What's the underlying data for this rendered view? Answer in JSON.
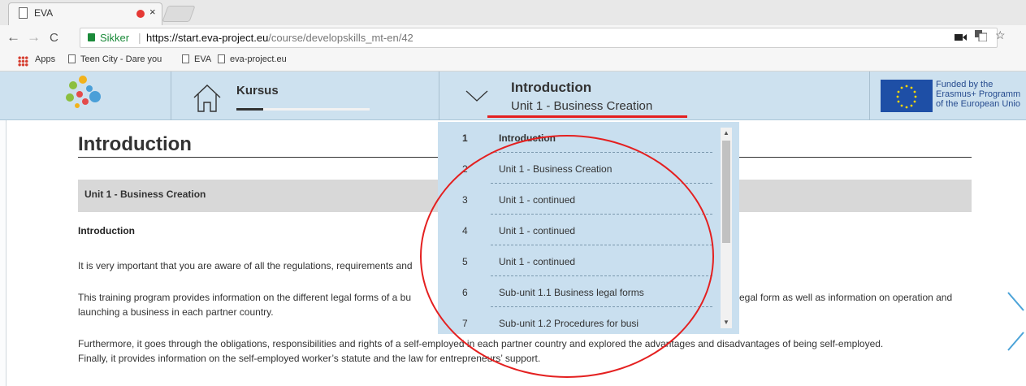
{
  "browser": {
    "tab": {
      "title": "EVA",
      "close": "×"
    },
    "address": {
      "secure_label": "Sikker",
      "url_host": "https://start.eva-project.eu",
      "url_path": "/course/developskills_mt-en/42"
    },
    "nav": {
      "back": "←",
      "forward": "→",
      "reload": "C"
    },
    "bookmarks": [
      {
        "label": "Apps"
      },
      {
        "label": "Teen City - Dare you"
      },
      {
        "label": "EVA"
      },
      {
        "label": "eva-project.eu"
      }
    ],
    "toolbar_icons": [
      "camera-icon",
      "translate-icon",
      "star-icon"
    ]
  },
  "header": {
    "course_label": "Kursus",
    "progress": 0.2,
    "section_title": "Introduction",
    "section_subtitle": "Unit 1 - Business Creation",
    "funding_lines": [
      "Funded by the",
      "Erasmus+ Programm",
      "of the European Unio"
    ]
  },
  "page": {
    "title": "Introduction",
    "unit_title": "Unit 1 - Business Creation",
    "sub_heading": "Introduction",
    "paragraphs": [
      [
        "It is very important that you are aware of all the regulations, requirements and"
      ],
      [
        "This training program provides information on the different legal forms of a bu",
        "egal form as well as information on operation and",
        "launching a business in each partner country."
      ],
      [
        "Furthermore, it goes through the obligations, responsibilities and rights of a self-employed in each partner country and explored the advantages and disadvantages of being self-employed.",
        "Finally, it provides information on the self-employed worker’s statute and the law for entrepreneurs’ support."
      ]
    ]
  },
  "dropdown": {
    "items": [
      {
        "num": "1",
        "label": "Introduction",
        "active": true
      },
      {
        "num": "2",
        "label": "Unit 1 - Business Creation"
      },
      {
        "num": "3",
        "label": "Unit 1 - continued"
      },
      {
        "num": "4",
        "label": "Unit 1 - continued"
      },
      {
        "num": "5",
        "label": "Unit 1 - continued"
      },
      {
        "num": "6",
        "label": "Sub-unit 1.1 Business legal forms"
      },
      {
        "num": "7",
        "label": "Sub-unit 1.2 Procedures for busi"
      }
    ]
  },
  "colors": {
    "header_bg": "#cde1ef",
    "dropdown_bg": "#c9dfef",
    "annotation_red": "#e42020",
    "secure_green": "#1b8a3a"
  }
}
